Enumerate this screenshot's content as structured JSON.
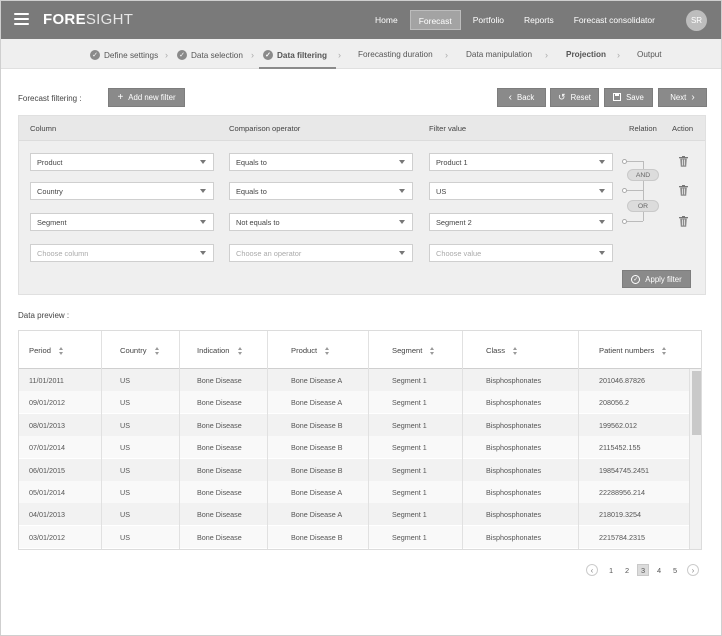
{
  "app": {
    "logo_a": "FORE",
    "logo_b": "SIGHT"
  },
  "topnav": {
    "items": [
      "Home",
      "Forecast",
      "Portfolio",
      "Reports",
      "Forecast consolidator"
    ],
    "active": "Forecast",
    "avatar": "SR"
  },
  "steps": {
    "items": [
      "Define settings",
      "Data selection",
      "Data filtering",
      "Forecasting duration",
      "Data manipulation",
      "Projection",
      "Output"
    ],
    "completed": [
      "Define settings",
      "Data selection",
      "Data filtering"
    ],
    "current": "Data filtering"
  },
  "toolbar": {
    "filtering_label": "Forecast filtering :",
    "add_filter": "Add new filter",
    "back": "Back",
    "reset": "Reset",
    "save": "Save",
    "next": "Next"
  },
  "filters": {
    "headers": {
      "column": "Column",
      "operator": "Comparison operator",
      "value": "Filter value",
      "relation": "Relation",
      "action": "Action"
    },
    "rows": [
      {
        "column": "Product",
        "operator": "Equals to",
        "value": "Product 1"
      },
      {
        "column": "Country",
        "operator": "Equals to",
        "value": "US"
      },
      {
        "column": "Segment",
        "operator": "Not equals to",
        "value": "Segment 2"
      }
    ],
    "placeholders": {
      "column": "Choose column",
      "operator": "Choose an operator",
      "value": "Choose value"
    },
    "relations": [
      "AND",
      "OR"
    ],
    "apply": "Apply filter"
  },
  "preview": {
    "label": "Data preview :",
    "columns": [
      "Period",
      "Country",
      "Indication",
      "Product",
      "Segment",
      "Class",
      "Patient numbers"
    ],
    "rows": [
      [
        "11/01/2011",
        "US",
        "Bone Disease",
        "Bone Disease A",
        "Segment 1",
        "Bisphosphonates",
        "201046.87826"
      ],
      [
        "09/01/2012",
        "US",
        "Bone Disease",
        "Bone Disease A",
        "Segment 1",
        "Bisphosphonates",
        "208056.2"
      ],
      [
        "08/01/2013",
        "US",
        "Bone Disease",
        "Bone Disease B",
        "Segment 1",
        "Bisphosphonates",
        "199562.012"
      ],
      [
        "07/01/2014",
        "US",
        "Bone Disease",
        "Bone Disease B",
        "Segment 1",
        "Bisphosphonates",
        "2115452.155"
      ],
      [
        "06/01/2015",
        "US",
        "Bone Disease",
        "Bone Disease B",
        "Segment 1",
        "Bisphosphonates",
        "19854745.2451"
      ],
      [
        "05/01/2014",
        "US",
        "Bone Disease",
        "Bone Disease A",
        "Segment 1",
        "Bisphosphonates",
        "22288956.214"
      ],
      [
        "04/01/2013",
        "US",
        "Bone Disease",
        "Bone Disease A",
        "Segment 1",
        "Bisphosphonates",
        "218019.3254"
      ],
      [
        "03/01/2012",
        "US",
        "Bone Disease",
        "Bone Disease B",
        "Segment 1",
        "Bisphosphonates",
        "2215784.2315"
      ]
    ]
  },
  "pagination": {
    "pages": [
      "1",
      "2",
      "3",
      "4",
      "5"
    ],
    "current": "3"
  }
}
